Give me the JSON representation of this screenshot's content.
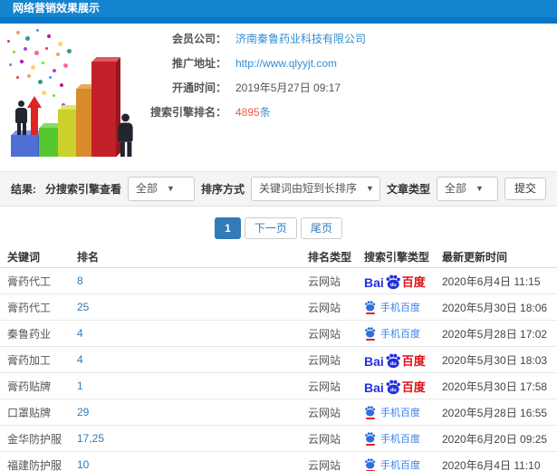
{
  "header": {
    "title": "网络营销效果展示"
  },
  "info": {
    "rows": [
      {
        "label": "会员公司：",
        "value": "济南秦鲁药业科技有限公司",
        "type": "link"
      },
      {
        "label": "推广地址：",
        "value": "http://www.qlyyjt.com",
        "type": "link"
      },
      {
        "label": "开通时间：",
        "value": "2019年5月27日 09:17",
        "type": "plain"
      }
    ],
    "rank_row": {
      "label": "搜索引擎排名：",
      "count": "4895",
      "unit": "条"
    }
  },
  "filters": {
    "result_label": "结果:",
    "engine_label": "分搜索引擎查看",
    "engine_value": "全部",
    "sort_label": "排序方式",
    "sort_value": "关键词由短到长排序",
    "article_label": "文章类型",
    "article_value": "全部",
    "submit_label": "提交",
    "caret": "▼"
  },
  "pagination": {
    "current": "1",
    "next_label": "下一页",
    "last_label": "尾页"
  },
  "table": {
    "headers": [
      "关键词",
      "排名",
      "排名类型",
      "搜索引擎类型",
      "最新更新时间"
    ],
    "rows": [
      {
        "keyword": "膏药代工",
        "rank": "8",
        "rank_type": "云网站",
        "engine": "baidu-pc",
        "updated": "2020年6月4日 11:15"
      },
      {
        "keyword": "膏药代工",
        "rank": "25",
        "rank_type": "云网站",
        "engine": "baidu-mobile",
        "updated": "2020年5月30日 18:06"
      },
      {
        "keyword": "秦鲁药业",
        "rank": "4",
        "rank_type": "云网站",
        "engine": "baidu-mobile",
        "updated": "2020年5月28日 17:02"
      },
      {
        "keyword": "膏药加工",
        "rank": "4",
        "rank_type": "云网站",
        "engine": "baidu-pc",
        "updated": "2020年5月30日 18:03"
      },
      {
        "keyword": "膏药贴牌",
        "rank": "1",
        "rank_type": "云网站",
        "engine": "baidu-pc",
        "updated": "2020年5月30日 17:58"
      },
      {
        "keyword": "口罩贴牌",
        "rank": "29",
        "rank_type": "云网站",
        "engine": "baidu-mobile",
        "updated": "2020年5月28日 16:55"
      },
      {
        "keyword": "金华防护服",
        "rank": "17,25",
        "rank_type": "云网站",
        "engine": "baidu-mobile",
        "updated": "2020年6月20日 09:25"
      },
      {
        "keyword": "福建防护服",
        "rank": "10",
        "rank_type": "云网站",
        "engine": "baidu-mobile",
        "updated": "2020年6月4日 11:10"
      }
    ]
  },
  "engines": {
    "pc": {
      "bai": "Bai",
      "du": "du",
      "cn": "百度"
    },
    "mobile": {
      "label": "手机百度"
    }
  },
  "colors": {
    "header_blue": "#1484cf",
    "header_blue_dark": "#0b75c5",
    "link_blue": "#2f8fd6",
    "rank_blue": "#337ab7",
    "count_red": "#ef5b41",
    "baidu_blue": "#2430df",
    "baidu_red": "#de0f17",
    "mobile_blue": "#3a7fe8"
  }
}
